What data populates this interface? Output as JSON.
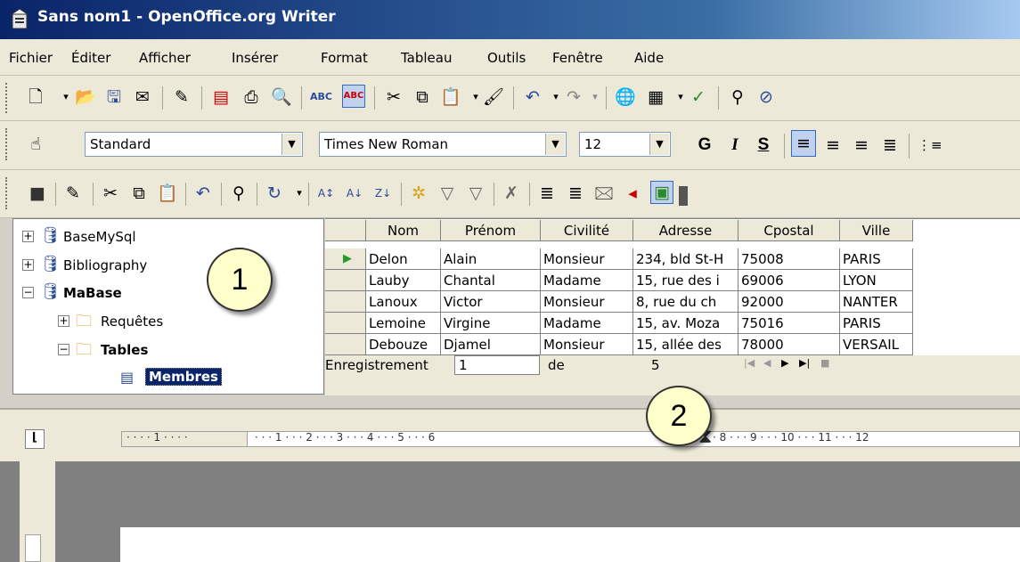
{
  "window": {
    "title": "Sans nom1 - OpenOffice.org Writer"
  },
  "menu": [
    "Fichier",
    "Éditer",
    "Afficher",
    "Insérer",
    "Format",
    "Tableau",
    "Outils",
    "Fenêtre",
    "Aide"
  ],
  "format_toolbar": {
    "style_value": "Standard",
    "font_value": "Times New Roman",
    "size_value": "12",
    "bold_label": "G",
    "italic_label": "I",
    "underline_label": "S"
  },
  "navigator": {
    "items": [
      {
        "label": "BaseMySql"
      },
      {
        "label": "Bibliography"
      },
      {
        "label": "MaBase"
      },
      {
        "label": "Requêtes"
      },
      {
        "label": "Tables"
      },
      {
        "label": "Membres"
      }
    ]
  },
  "table": {
    "columns": [
      "Nom",
      "Prénom",
      "Civilité",
      "Adresse",
      "Cpostal",
      "Ville"
    ],
    "rows": [
      [
        "Delon",
        "Alain",
        "Monsieur",
        "234, bld St-H",
        "75008",
        "PARIS"
      ],
      [
        "Lauby",
        "Chantal",
        "Madame",
        "15, rue des i",
        "69006",
        "LYON"
      ],
      [
        "Lanoux",
        "Victor",
        "Monsieur",
        "8, rue du ch",
        "92000",
        "NANTER"
      ],
      [
        "Lemoine",
        "Virgine",
        "Madame",
        "15, av. Moza",
        "75016",
        "PARIS"
      ],
      [
        "Debouze",
        "Djamel",
        "Monsieur",
        "15, allée des",
        "78000",
        "VERSAIL"
      ]
    ]
  },
  "record_nav": {
    "label": "Enregistrement",
    "current": "1",
    "of_label": "de",
    "total": "5"
  },
  "callouts": [
    "1",
    "2"
  ],
  "ruler": {
    "marks": [
      "1",
      "1",
      "2",
      "3",
      "4",
      "5",
      "6",
      "8",
      "9",
      "10",
      "11",
      "12"
    ]
  }
}
